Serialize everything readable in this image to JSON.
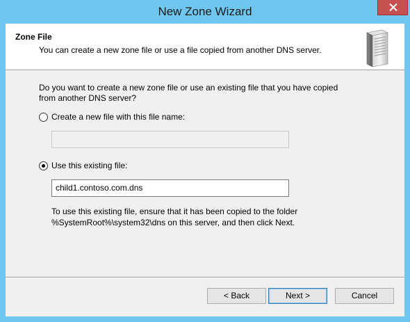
{
  "window": {
    "title": "New Zone Wizard"
  },
  "header": {
    "title": "Zone File",
    "subtitle": "You can create a new zone file or use a file copied from another DNS server."
  },
  "body": {
    "question_line1": "Do you want to create a new zone file or use an existing file that you have copied",
    "question_line2": "from another DNS server?",
    "option_new": {
      "label": "Create a new file with this file name:",
      "selected": false,
      "value": ""
    },
    "option_existing": {
      "label": "Use this existing file:",
      "selected": true,
      "value": "child1.contoso.com.dns"
    },
    "note_line1": "To use this existing file, ensure that it has been copied to the folder",
    "note_line2": "%SystemRoot%\\system32\\dns on this server, and then click Next."
  },
  "buttons": {
    "back": "< Back",
    "next": "Next >",
    "cancel": "Cancel"
  },
  "icons": {
    "close": "close-icon",
    "server": "server-icon"
  },
  "colors": {
    "frame": "#6fc6ee",
    "close_button": "#c75050",
    "dialog_bg": "#f0f0f0"
  }
}
